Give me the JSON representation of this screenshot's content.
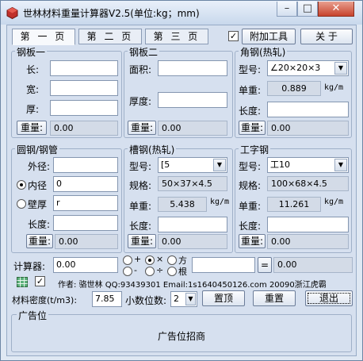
{
  "window": {
    "title": "世林材料重量计算器V2.5(单位:kg；mm)",
    "minimize_label": "–",
    "maximize_label": "□",
    "close_label": "✕"
  },
  "tabs": [
    {
      "label": "第 一 页",
      "active": true
    },
    {
      "label": "第 二 页",
      "active": false
    },
    {
      "label": "第 三 页",
      "active": false
    }
  ],
  "extra_tools": {
    "checked": true,
    "label": "附加工具"
  },
  "about_label": "关 于",
  "steel_plate_1": {
    "title": "钢板一",
    "length_label": "长:",
    "length_value": "",
    "width_label": "宽:",
    "width_value": "",
    "thickness_label": "厚:",
    "thickness_value": "",
    "weight_button": "重量:",
    "weight_value": "0.00"
  },
  "steel_plate_2": {
    "title": "钢板二",
    "area_label": "面积:",
    "area_value": "",
    "thickness_label": "厚度:",
    "thickness_value": "",
    "weight_button": "重量:",
    "weight_value": "0.00"
  },
  "angle_steel": {
    "title": "角钢(热轧)",
    "model_label": "型号:",
    "model_value": "∠20×20×3",
    "unit_weight_label": "单重:",
    "unit_weight_value": "0.889",
    "unit_weight_unit": "kg/m",
    "length_label": "长度:",
    "length_value": "",
    "weight_button": "重量:",
    "weight_value": "0.00"
  },
  "round_steel": {
    "title": "圆钢/钢管",
    "outer_label": "外径:",
    "outer_value": "",
    "inner_label": "内径",
    "inner_value": "0",
    "inner_selected": true,
    "wall_label": "壁厚",
    "wall_value": "r",
    "wall_selected": false,
    "length_label": "长度:",
    "length_value": "",
    "weight_button": "重量:",
    "weight_value": "0.00"
  },
  "channel_steel": {
    "title": "槽钢(热轧)",
    "model_label": "型号:",
    "model_value": "[5",
    "spec_label": "规格:",
    "spec_value": "50×37×4.5",
    "unit_weight_label": "单重:",
    "unit_weight_value": "5.438",
    "unit_weight_unit": "kg/m",
    "length_label": "长度:",
    "length_value": "",
    "weight_button": "重量:",
    "weight_value": "0.00"
  },
  "i_beam": {
    "title": "工字钢",
    "model_label": "型号:",
    "model_value": "工10",
    "spec_label": "规格:",
    "spec_value": "100×68×4.5",
    "unit_weight_label": "单重:",
    "unit_weight_value": "11.261",
    "unit_weight_unit": "kg/m",
    "length_label": "长度:",
    "length_value": "",
    "weight_button": "重量:",
    "weight_value": "0.00"
  },
  "calculator": {
    "label": "计算器:",
    "operand1": "0.00",
    "operators": [
      {
        "symbol": "+",
        "selected": false
      },
      {
        "symbol": "×",
        "selected": true
      },
      {
        "symbol": "方",
        "selected": false
      },
      {
        "symbol": "-",
        "selected": false
      },
      {
        "symbol": "÷",
        "selected": false
      },
      {
        "symbol": "根",
        "selected": false
      }
    ],
    "operand2": "",
    "equals_label": "=",
    "result": "0.00"
  },
  "author_line": "作者: 骆世林 QQ:93439301 Email:1s1640450126.com  20090浙江虎霸",
  "always_on_top": {
    "checked": true
  },
  "density": {
    "label": "材料密度(t/m3):",
    "value": "7.85"
  },
  "decimals": {
    "label": "小数位数:",
    "value": "2"
  },
  "buttons": {
    "top": "置顶",
    "reset": "重置",
    "exit": "退出"
  },
  "ad": {
    "title": "广告位",
    "text": "广告位招商"
  }
}
